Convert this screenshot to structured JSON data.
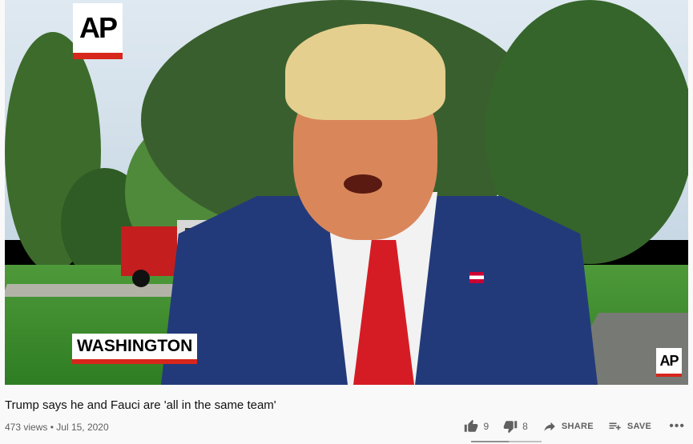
{
  "video": {
    "overlay_logo_text": "AP",
    "location_caption": "WASHINGTON",
    "corner_logo_text": "AP"
  },
  "info": {
    "title": "Trump says he and Fauci are 'all in the same team'",
    "views": "473 views",
    "separator": "•",
    "date": "Jul 15, 2020"
  },
  "actions": {
    "like_count": "9",
    "dislike_count": "8",
    "share_label": "SHARE",
    "save_label": "SAVE",
    "more_label": "•••"
  },
  "sentiment": {
    "like_ratio": 0.53
  },
  "colors": {
    "ap_red": "#d7261b",
    "icon_gray": "#606060"
  }
}
